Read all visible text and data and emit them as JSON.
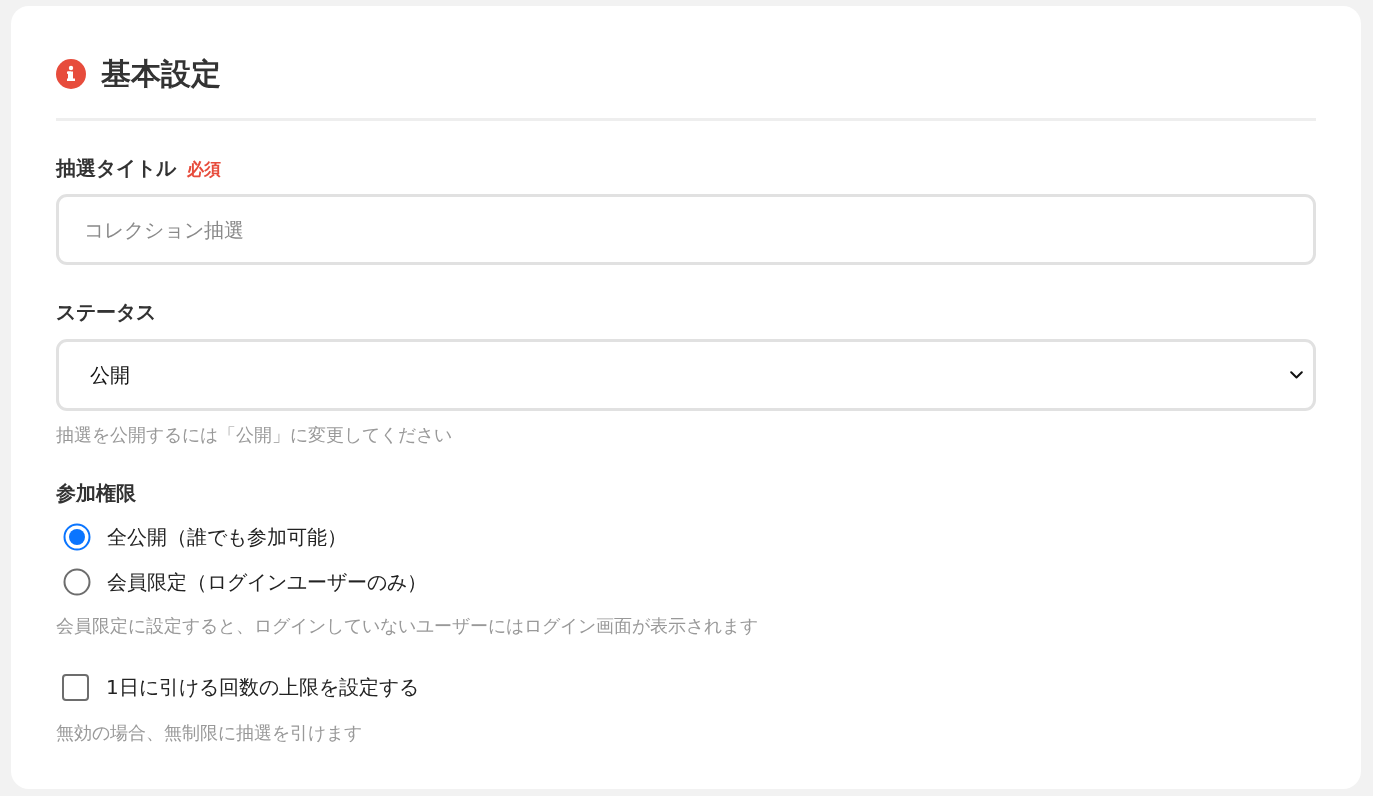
{
  "section": {
    "title": "基本設定"
  },
  "fields": [
    {
      "kind": "text",
      "label": "抽選タイトル",
      "required_badge": "必須",
      "placeholder": "コレクション抽選"
    },
    {
      "kind": "select",
      "label": "ステータス",
      "value": "公開",
      "hint": "抽選を公開するには「公開」に変更してください"
    },
    {
      "kind": "radio",
      "label": "参加権限",
      "options": [
        {
          "label": "全公開（誰でも参加可能）",
          "selected": true
        },
        {
          "label": "会員限定（ログインユーザーのみ）",
          "selected": false
        }
      ],
      "hint": "会員限定に設定すると、ログインしていないユーザーにはログイン画面が表示されます"
    },
    {
      "kind": "checkbox",
      "label": "1日に引ける回数の上限を設定する",
      "checked": false,
      "hint": "無効の場合、無制限に抽選を引けます"
    }
  ]
}
